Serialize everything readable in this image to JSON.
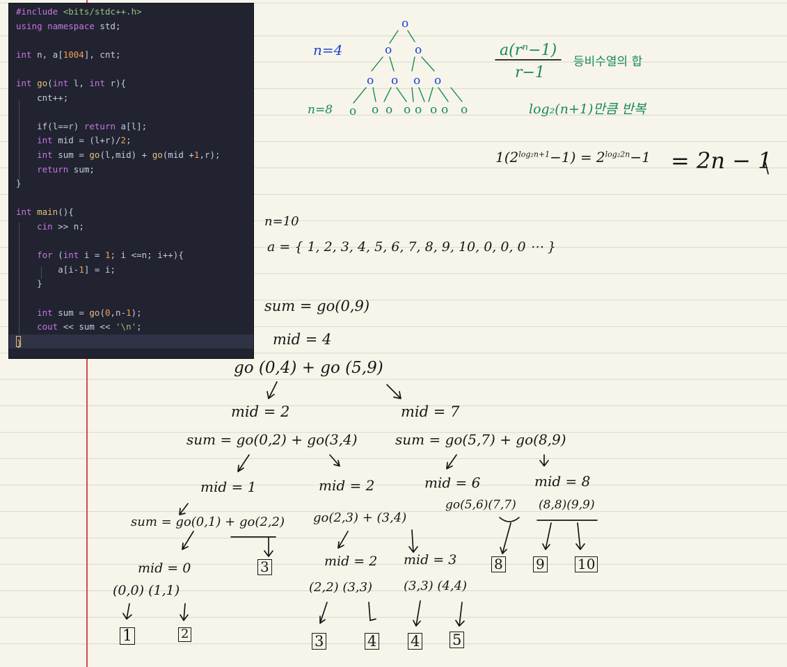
{
  "code": {
    "lines": [
      "#include <bits/stdc++.h>",
      "using namespace std;",
      "",
      "int n, a[1004], cnt;",
      "",
      "int go(int l, int r){",
      "    cnt++;",
      "",
      "    if(l==r) return a[l];",
      "    int mid = (l+r)/2;",
      "    int sum = go(l,mid) + go(mid +1,r);",
      "    return sum;",
      "}",
      "",
      "int main(){",
      "    cin >> n;",
      "",
      "    for (int i = 1; i <=n; i++){",
      "        a[i-1] = i;",
      "    }",
      "",
      "    int sum = go(0,n-1);",
      "    cout << sum << '\\n';",
      "}"
    ],
    "colors": {
      "background": "#212331",
      "keyword": "#c678dd",
      "function": "#e5c07b",
      "number": "#f5a04e",
      "string": "#98c379",
      "text": "#c8ccdb"
    }
  },
  "notes": {
    "n4": "n=4",
    "n8": "n=8",
    "tree_node": "o",
    "geo_num": "a(rⁿ−1)",
    "geo_den": "r−1",
    "geo_label": "등비수열의 합",
    "log_note": "log₂(n+1)만큼 반복",
    "formula_lhs": "1(2",
    "formula_exp1": "log₂n+1",
    "formula_mid": "−1) = 2",
    "formula_exp2": "log₂2n",
    "formula_tail": "−1",
    "formula_result": "= 2n − 1",
    "n10": "n=10",
    "array": "a = { 1, 2, 3, 4, 5, 6, 7, 8, 9, 10, 0, 0, 0 ⋯ }",
    "sum_root": "sum = go(0,9)",
    "mid_root": "mid = 4",
    "split_root": "go (0,4) + go (5,9)",
    "left_mid": "mid = 2",
    "right_mid": "mid = 7",
    "left_sum": "sum = go(0,2) + go(3,4)",
    "right_sum": "sum = go(5,7) + go(8,9)",
    "ll_mid": "mid = 1",
    "lr_mid": "mid = 2",
    "rl_mid": "mid = 6",
    "rr_mid": "mid = 8",
    "ll_sum": "sum = go(0,1) + go(2,2)",
    "lr_split": "go(2,3) + (3,4)",
    "rl_split": "go(5,6)(7,7)",
    "rr_split": "(8,8)(9,9)",
    "lll_mid": "mid = 0",
    "lrl_mid": "mid = 2",
    "lrr_mid": "mid = 3",
    "leaf_pairs_1": "(0,0)  (1,1)",
    "leaf_pairs_2": "(2,2)  (3,3)",
    "leaf_pairs_3": "(3,3)  (4,4)",
    "boxes": [
      "1",
      "2",
      "3",
      "3",
      "4",
      "4",
      "5",
      "8",
      "9",
      "10"
    ]
  }
}
